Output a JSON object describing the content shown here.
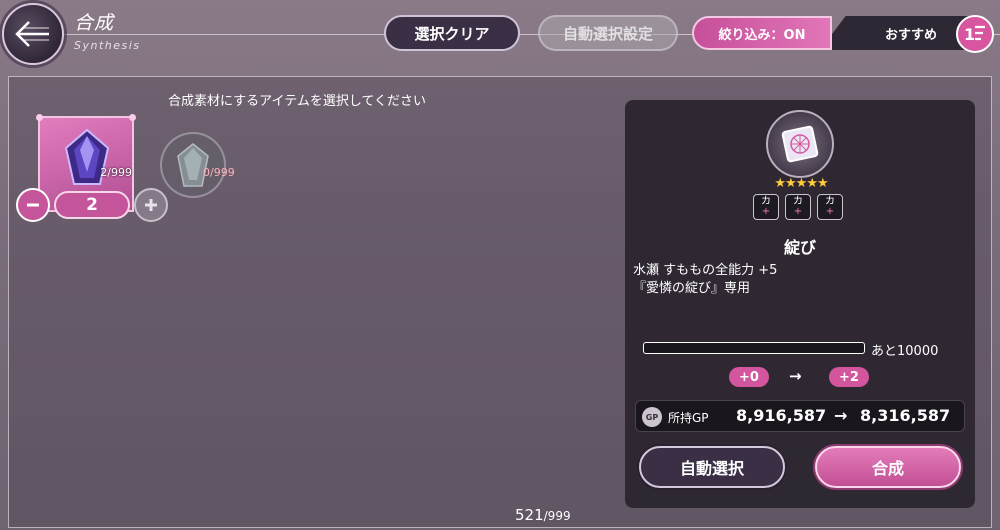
{
  "header": {
    "title": "合成",
    "subtitle": "Synthesis",
    "clear_button": "選択クリア",
    "auto_setting_button": "自動選択設定",
    "filter_label": "絞り込み：ON",
    "sort_label": "おすすめ",
    "icons": {
      "back": "back-arrow-icon",
      "sort": "sort-order-icon"
    }
  },
  "materials": {
    "instruction": "合成素材にするアイテムを選択してください",
    "items": [
      {
        "count": "2/999",
        "selected_qty": "2",
        "state": "selected",
        "icon": "purple-crystal-icon"
      },
      {
        "count": "0/999",
        "state": "unselected",
        "icon": "clear-crystal-icon"
      }
    ],
    "total": "521",
    "total_max": "/999"
  },
  "detail": {
    "icon": "card-emblem-icon",
    "stars": "★★★★★",
    "rarity": 5,
    "stat_tags": [
      {
        "label": "カ",
        "plus": "+"
      },
      {
        "label": "カ",
        "plus": "+"
      },
      {
        "label": "カ",
        "plus": "+"
      }
    ],
    "name": "綻び",
    "description_line1": "水瀬 すももの全能力 +5",
    "description_line2": "『愛憐の綻び』専用",
    "progress": 0,
    "remaining": "あと10000",
    "level_from": "+0",
    "level_arrow": "→",
    "level_to": "+2",
    "gp_icon_text": "GP",
    "gp_label": "所持GP",
    "gp_from": "8,916,587",
    "gp_arrow": "→",
    "gp_to": "8,316,587",
    "auto_select_button": "自動選択",
    "synthesize_button": "合成"
  },
  "colors": {
    "accent_pink": "#d2559d",
    "panel_dark": "#2a242e",
    "star_gold": "#ffcc3a"
  }
}
